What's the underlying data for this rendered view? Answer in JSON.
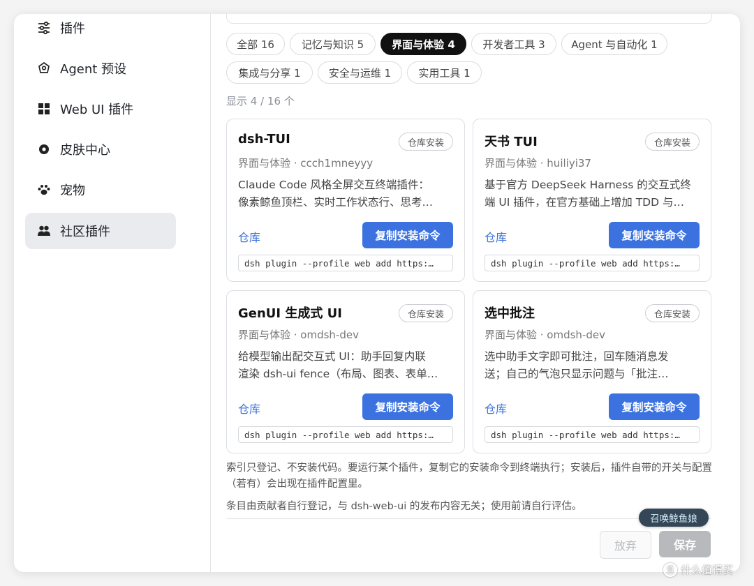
{
  "sidebar": {
    "items": [
      {
        "label": "插件",
        "icon": "sliders-icon"
      },
      {
        "label": "Agent 预设",
        "icon": "agent-preset-icon"
      },
      {
        "label": "Web UI 插件",
        "icon": "grid-icon"
      },
      {
        "label": "皮肤中心",
        "icon": "target-icon"
      },
      {
        "label": "宠物",
        "icon": "paw-icon"
      },
      {
        "label": "社区插件",
        "icon": "community-icon",
        "active": true
      }
    ]
  },
  "filters": [
    {
      "label": "全部 16"
    },
    {
      "label": "记忆与知识 5"
    },
    {
      "label": "界面与体验 4",
      "active": true
    },
    {
      "label": "开发者工具 3"
    },
    {
      "label": "Agent 与自动化 1"
    },
    {
      "label": "集成与分享 1"
    },
    {
      "label": "安全与运维 1"
    },
    {
      "label": "实用工具 1"
    }
  ],
  "count_text": "显示 4 / 16 个",
  "cards": [
    {
      "title": "dsh-TUI",
      "badge": "仓库安装",
      "meta": "界面与体验 · ccch1mneyyy",
      "desc_line1": "Claude Code 风格全屏交互终端插件：",
      "desc_line2": "像素鲸鱼顶栏、实时工作状态行、思考…",
      "repo": "仓库",
      "copy": "复制安装命令",
      "cmd": "dsh plugin --profile web add https:…"
    },
    {
      "title": "天书 TUI",
      "badge": "仓库安装",
      "meta": "界面与体验 · huiliyi37",
      "desc_line1": "基于官方 DeepSeek Harness 的交互式终",
      "desc_line2": "端 UI 插件，在官方基础上增加 TDD 与…",
      "repo": "仓库",
      "copy": "复制安装命令",
      "cmd": "dsh plugin --profile web add https:…"
    },
    {
      "title": "GenUI 生成式 UI",
      "badge": "仓库安装",
      "meta": "界面与体验 · omdsh-dev",
      "desc_line1": "给模型输出配交互式 UI：助手回复内联",
      "desc_line2": "渲染 dsh-ui fence（布局、图表、表单…",
      "repo": "仓库",
      "copy": "复制安装命令",
      "cmd": "dsh plugin --profile web add https:…"
    },
    {
      "title": "选中批注",
      "badge": "仓库安装",
      "meta": "界面与体验 · omdsh-dev",
      "desc_line1": "选中助手文字即可批注，回车随消息发",
      "desc_line2": "送；自己的气泡只显示问题与「批注…",
      "repo": "仓库",
      "copy": "复制安装命令",
      "cmd": "dsh plugin --profile web add https:…"
    }
  ],
  "notes": {
    "line1": "索引只登记、不安装代码。要运行某个插件，复制它的安装命令到终端执行；安装后，插件自带的开关与配置（若有）会出现在插件配置里。",
    "line2": "条目由贡献者自行登记，与 dsh-web-ui 的发布内容无关；使用前请自行评估。"
  },
  "buttons": {
    "discard": "放弃",
    "save": "保存"
  },
  "summon": "召唤鲸鱼娘",
  "watermark": "什么值得买",
  "colors": {
    "accent": "#3b72e0",
    "active_chip": "#111111",
    "save_disabled": "#b7b9bd"
  }
}
